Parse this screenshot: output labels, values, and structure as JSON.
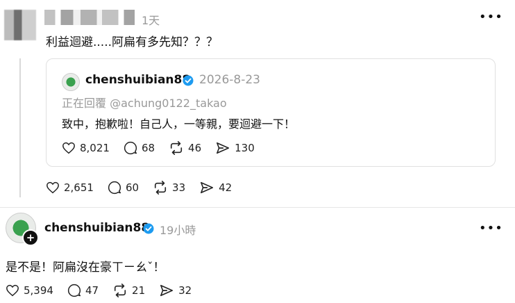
{
  "post1": {
    "time": "1天",
    "text": "利益迴避.....阿扁有多先知？？？"
  },
  "quote": {
    "username": "chenshuibian88",
    "date": "2026-8-23",
    "replying_to": "正在回覆 @achung0122_takao",
    "text": "致中，抱歉啦！自己人，一等親，要迴避一下！",
    "likes": "8,021",
    "comments": "68",
    "reposts": "46",
    "shares": "130"
  },
  "post1_stats": {
    "likes": "2,651",
    "comments": "60",
    "reposts": "33",
    "shares": "42"
  },
  "post2": {
    "username": "chenshuibian88",
    "time": "19小時",
    "text": "是不是！阿扁沒在豪ㄒㄧㄠˇ！",
    "likes": "5,394",
    "comments": "47",
    "reposts": "21",
    "shares": "32"
  },
  "icons": {
    "more": "more-horizontal-icon",
    "like": "heart-icon",
    "comment": "comment-icon",
    "repost": "repost-icon",
    "share": "share-icon",
    "verified": "verified-badge-icon",
    "follow": "plus-icon"
  },
  "colors": {
    "verified": "#1d9bf0",
    "muted": "#999999",
    "text": "#111111"
  }
}
